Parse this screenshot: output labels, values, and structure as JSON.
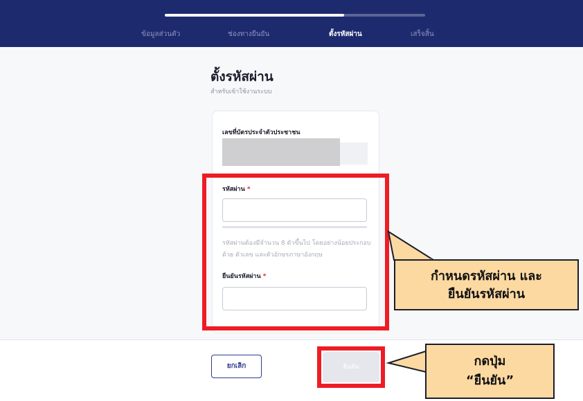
{
  "steps": {
    "progress": 0.69,
    "items": [
      "ข้อมูลส่วนตัว",
      "ช่องทางยืนยัน",
      "ตั้งรหัสผ่าน",
      "เสร็จสิ้น"
    ],
    "active_index": 2
  },
  "page": {
    "title": "ตั้งรหัสผ่าน",
    "subtitle": "สำหรับเข้าใช้งานระบบ"
  },
  "form": {
    "id_label": "เลขที่บัตรประจำตัวประชาชน",
    "password_label": "รหัสผ่าน",
    "password_value": "",
    "required_mark": "*",
    "hint": "รหัสผ่านต้องมีจำนวน 8 ตัวขึ้นไป โดยอย่างน้อยประกอบด้วย ตัวเลข และตัวอักษรภาษาอังกฤษ",
    "confirm_label": "ยืนยันรหัสผ่าน",
    "confirm_value": ""
  },
  "buttons": {
    "cancel": "ยกเลิก",
    "confirm": "ยืนยัน"
  },
  "annotations": {
    "callout_password_line1": "กำหนดรหัสผ่าน และ",
    "callout_password_line2": "ยืนยันรหัสผ่าน",
    "callout_button_line1": "กดปุ่ม",
    "callout_button_line2": "“ยืนยัน”"
  },
  "colors": {
    "header_bg": "#1e2a6e",
    "highlight": "#ee1c24",
    "callout_fill": "#fdd9a2",
    "required": "#e0243a"
  }
}
